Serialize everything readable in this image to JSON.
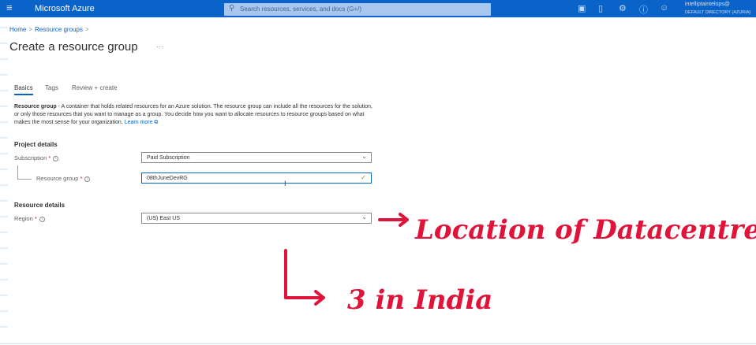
{
  "topbar": {
    "menu_icon": "hamburger-icon",
    "brand": "Microsoft Azure",
    "search_placeholder": "Search resources, services, and docs (G+/)",
    "icons": [
      "cloud-shell-icon",
      "notifications-icon",
      "settings-icon",
      "help-icon",
      "feedback-icon"
    ],
    "user_email": "intelliptaintelops@",
    "user_directory": "DEFAULT DIRECTORY (AZURIA)"
  },
  "breadcrumb": {
    "home": "Home",
    "resource_groups": "Resource groups"
  },
  "page": {
    "title": "Create a resource group",
    "more": "···"
  },
  "tabs": [
    "Basics",
    "Tags",
    "Review + create"
  ],
  "description": {
    "bold": "Resource group",
    "text": " - A container that holds related resources for an Azure solution. The resource group can include all the resources for the solution, or only those resources that you want to manage as a group. You decide how you want to allocate resources to resource groups based on what makes the most sense for your organization. ",
    "link": "Learn more"
  },
  "project_details": {
    "heading": "Project details",
    "subscription_label": "Subscription",
    "subscription_value": "Paid Subscription",
    "resource_group_label": "Resource group",
    "resource_group_value": "08thJuneDevRG"
  },
  "resource_details": {
    "heading": "Resource details",
    "region_label": "Region",
    "region_value": "(US) East US"
  },
  "annotations": {
    "arrow_note": "Location of Datacentre",
    "sub_note": "3 in India"
  },
  "colors": {
    "azure_blue": "#0a63c9",
    "annotation_red": "#e0143a",
    "required_red": "#a4262c"
  }
}
